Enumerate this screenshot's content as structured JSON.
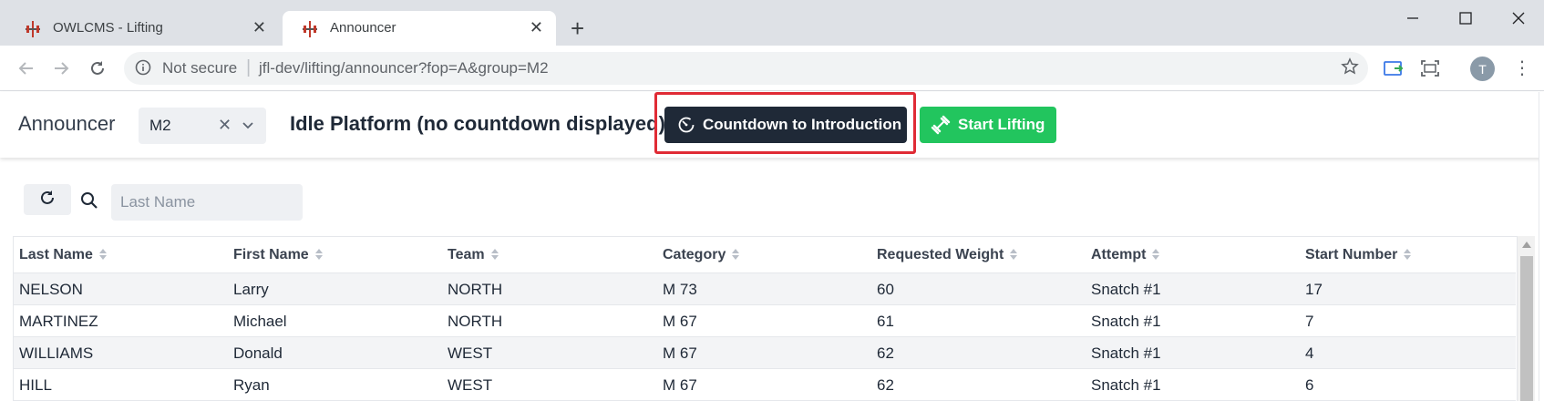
{
  "browser": {
    "tabs": [
      {
        "title": "OWLCMS - Lifting",
        "active": false
      },
      {
        "title": "Announcer",
        "active": true
      }
    ],
    "security_label": "Not secure",
    "url": "jfl-dev/lifting/announcer?fop=A&group=M2",
    "profile_initial": "T"
  },
  "header": {
    "title": "Announcer",
    "group_value": "M2",
    "status": "Idle Platform (no countdown displayed)",
    "countdown_button_label": "Countdown to Introduction",
    "start_button_label": "Start Lifting"
  },
  "filter": {
    "search_placeholder": "Last Name",
    "search_value": ""
  },
  "grid": {
    "columns": [
      "Last Name",
      "First Name",
      "Team",
      "Category",
      "Requested Weight",
      "Attempt",
      "Start Number"
    ],
    "rows": [
      [
        "NELSON",
        "Larry",
        "NORTH",
        "M 73",
        "60",
        "Snatch #1",
        "17"
      ],
      [
        "MARTINEZ",
        "Michael",
        "NORTH",
        "M 67",
        "61",
        "Snatch #1",
        "7"
      ],
      [
        "WILLIAMS",
        "Donald",
        "WEST",
        "M 67",
        "62",
        "Snatch #1",
        "4"
      ],
      [
        "HILL",
        "Ryan",
        "WEST",
        "M 67",
        "62",
        "Snatch #1",
        "6"
      ]
    ]
  },
  "colors": {
    "countdown_button": "#1f2937",
    "start_button": "#22c55e",
    "highlight": "#e02b35"
  }
}
